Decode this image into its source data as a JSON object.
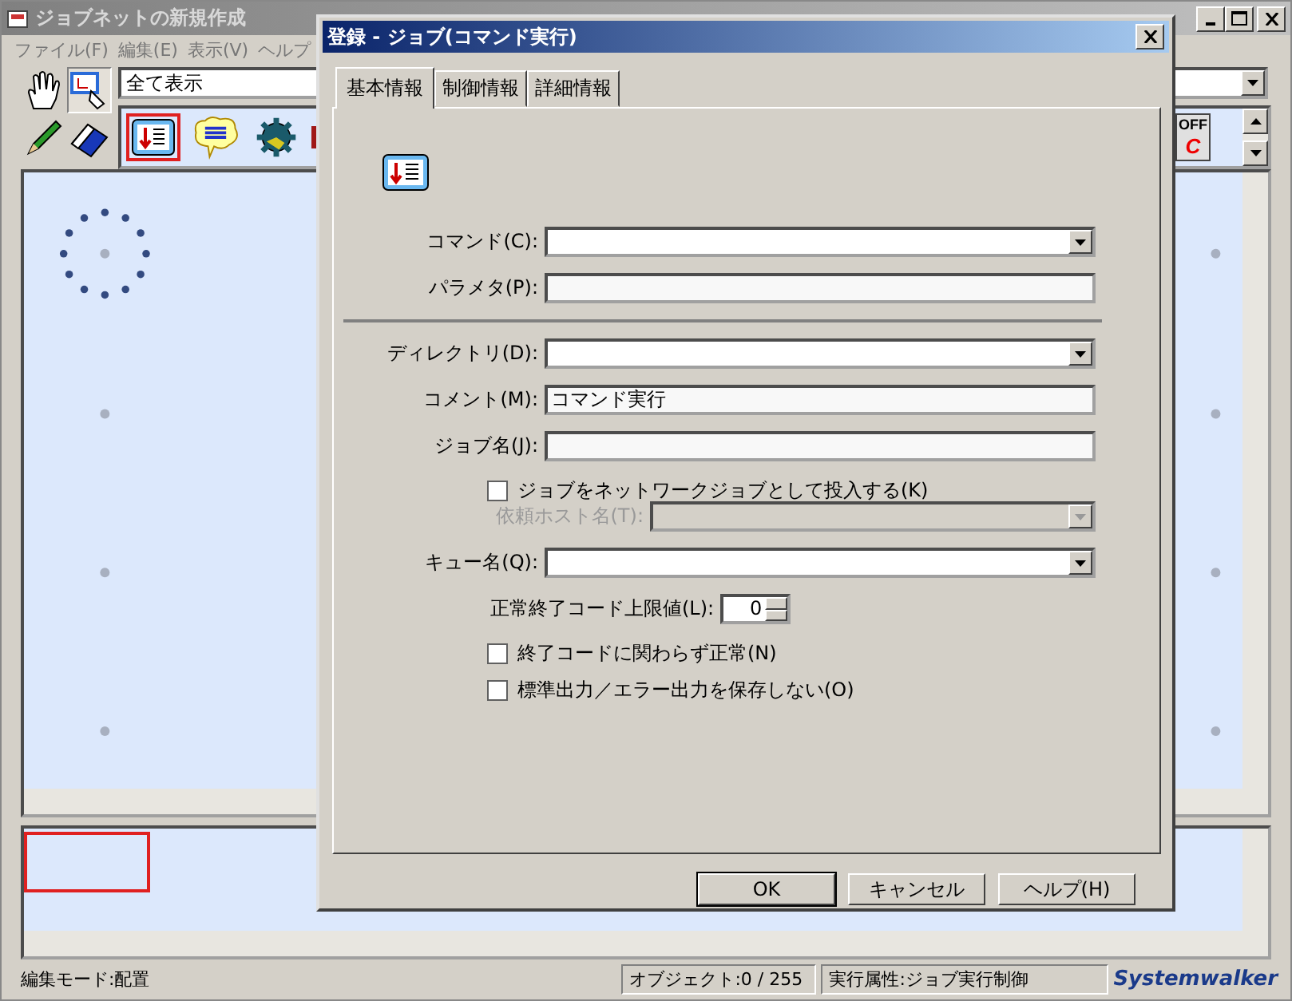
{
  "main_window": {
    "title": "ジョブネットの新規作成"
  },
  "menu": [
    "ファイル(F)",
    "編集(E)",
    "表示(V)",
    "ヘルプ"
  ],
  "view_combo": {
    "value": "全て表示"
  },
  "palette": [
    {
      "kind": "hand",
      "selected": false
    },
    {
      "kind": "select",
      "selected": true
    },
    {
      "kind": "pencil",
      "selected": false
    },
    {
      "kind": "eraser",
      "selected": false
    }
  ],
  "job_icons": [
    {
      "kind": "command",
      "selected": true
    },
    {
      "kind": "message",
      "selected": false
    },
    {
      "kind": "gear",
      "selected": false
    },
    {
      "kind": "flag",
      "selected": false
    }
  ],
  "off_button": {
    "label": "OFF",
    "letter": "C"
  },
  "status_bar": {
    "mode": "編集モード:配置",
    "objects": "オブジェクト:0 / 255",
    "attribute": "実行属性:ジョブ実行制御",
    "logo": "Systemwalker"
  },
  "dialog": {
    "title": "登録 - ジョブ(コマンド実行)",
    "tabs": [
      {
        "label": "基本情報",
        "selected": true
      },
      {
        "label": "制御情報",
        "selected": false
      },
      {
        "label": "詳細情報",
        "selected": false
      }
    ],
    "rows": [
      {
        "kind": "combo",
        "label": "コマンド(C):",
        "disabled": false
      },
      {
        "kind": "text",
        "label": "パラメタ(P):"
      },
      {
        "kind": "rule"
      },
      {
        "kind": "combo",
        "label": "ディレクトリ(D):",
        "disabled": false
      },
      {
        "kind": "text",
        "label": "コメント(M):",
        "value": "コマンド実行"
      },
      {
        "kind": "text",
        "label": "ジョブ名(J):"
      },
      {
        "kind": "check",
        "label": "ジョブをネットワークジョブとして投入する(K)",
        "checked": false
      },
      {
        "kind": "combo",
        "label": "依頼ホスト名(T):",
        "disabled": true
      },
      {
        "kind": "combo",
        "label": "キュー名(Q):",
        "disabled": false
      },
      {
        "kind": "spin",
        "label": "正常終了コード上限値(L):",
        "value": "0"
      },
      {
        "kind": "check",
        "label": "終了コードに関わらず正常(N)",
        "checked": false
      },
      {
        "kind": "check",
        "label": "標準出力／エラー出力を保存しない(O)",
        "checked": false
      }
    ],
    "buttons": [
      {
        "label": "OK",
        "default": true
      },
      {
        "label": "キャンセル",
        "default": false
      },
      {
        "label": "ヘルプ(H)",
        "default": false
      }
    ]
  }
}
